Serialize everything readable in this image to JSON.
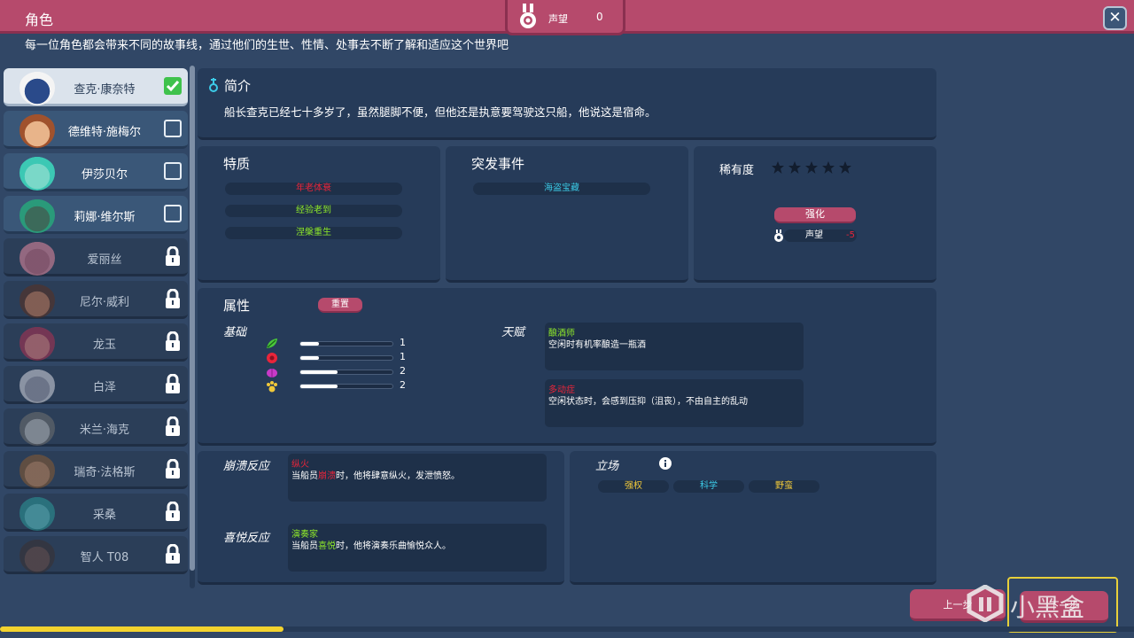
{
  "header": {
    "title": "角色",
    "reputation_label": "声望",
    "reputation_value": "0",
    "close": "✕"
  },
  "subtitle": "每一位角色都会带来不同的故事线，通过他们的生世、性情、处事去不断了解和适应这个世界吧",
  "characters": [
    {
      "name": "查克·康奈特",
      "state": "selected"
    },
    {
      "name": "德维特·施梅尔",
      "state": "available"
    },
    {
      "name": "伊莎贝尔",
      "state": "available"
    },
    {
      "name": "莉娜·维尔斯",
      "state": "available"
    },
    {
      "name": "爱丽丝",
      "state": "locked"
    },
    {
      "name": "尼尔·威利",
      "state": "locked"
    },
    {
      "name": "龙玉",
      "state": "locked"
    },
    {
      "name": "白泽",
      "state": "locked"
    },
    {
      "name": "米兰·海克",
      "state": "locked"
    },
    {
      "name": "瑞奇·法格斯",
      "state": "locked"
    },
    {
      "name": "采桑",
      "state": "locked"
    },
    {
      "name": "智人 T08",
      "state": "locked"
    }
  ],
  "intro": {
    "title": "简介",
    "text": "船长查克已经七十多岁了，虽然腿脚不便，但他还是执意要驾驶这只船，他说这是宿命。"
  },
  "traits": {
    "title": "特质",
    "items": [
      {
        "label": "年老体衰",
        "color": "#e8253a"
      },
      {
        "label": "经验老到",
        "color": "#8ee82a"
      },
      {
        "label": "涅槃重生",
        "color": "#8ee82a"
      }
    ]
  },
  "events": {
    "title": "突发事件",
    "items": [
      {
        "label": "海盗宝藏",
        "color": "#3ccbe8"
      }
    ]
  },
  "rarity": {
    "title": "稀有度",
    "stars": 0,
    "max_stars": 5,
    "upgrade_label": "强化",
    "cost_label": "声望",
    "cost_value": "-5"
  },
  "attributes": {
    "title": "属性",
    "reset_label": "重置",
    "basic_label": "基础",
    "talent_label": "天赋",
    "stats": [
      {
        "icon": "green-leaf-icon",
        "value": 1
      },
      {
        "icon": "red-heart-icon",
        "value": 1
      },
      {
        "icon": "purple-brain-icon",
        "value": 2
      },
      {
        "icon": "yellow-paw-icon",
        "value": 2
      }
    ],
    "stat_max": 5,
    "talents": [
      {
        "name": "酿酒师",
        "color": "#8ee82a",
        "desc": "空闲时有机率酿造一瓶酒"
      },
      {
        "name": "多动症",
        "color": "#e8253a",
        "desc": "空闲状态时，会感到压抑（沮丧），不由自主的乱动"
      }
    ]
  },
  "reactions": {
    "breakdown_label": "崩溃反应",
    "breakdown": {
      "name": "纵火",
      "color": "#e8253a",
      "pre": "当船员",
      "keyword": "崩溃",
      "post": "时，他将肆意纵火，发泄愤怒。"
    },
    "joy_label": "喜悦反应",
    "joy": {
      "name": "演奏家",
      "color": "#8ee82a",
      "pre": "当船员",
      "keyword": "喜悦",
      "post": "时，他将演奏乐曲愉悦众人。"
    }
  },
  "stance": {
    "title": "立场",
    "items": [
      {
        "label": "强权",
        "color": "#f0c83a"
      },
      {
        "label": "科学",
        "color": "#3ccbe8"
      },
      {
        "label": "野蛮",
        "color": "#f0c83a"
      }
    ]
  },
  "footer": {
    "prev": "上一步",
    "next": "下一步",
    "progress": 0.25
  },
  "watermark": "小黑盒"
}
